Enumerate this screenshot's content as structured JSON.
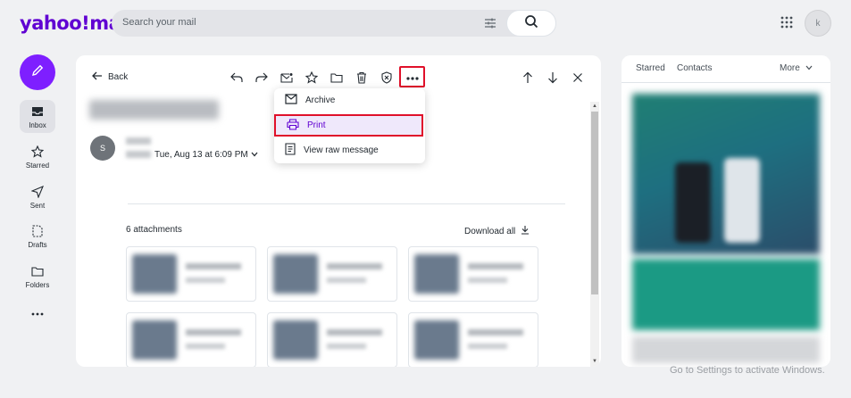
{
  "app": {
    "logo": "yahoo!mail"
  },
  "search": {
    "placeholder": "Search your mail"
  },
  "account": {
    "avatar_initial": "k"
  },
  "sidebar": {
    "items": [
      {
        "label": "Inbox"
      },
      {
        "label": "Starred"
      },
      {
        "label": "Sent"
      },
      {
        "label": "Drafts"
      },
      {
        "label": "Folders"
      }
    ]
  },
  "toolbar": {
    "back_label": "Back"
  },
  "message": {
    "sender_initial": "S",
    "date": "Tue, Aug 13 at 6:09 PM",
    "attachments_count_label": "6 attachments",
    "download_all_label": "Download all"
  },
  "more_menu": {
    "items": [
      {
        "label": "Archive"
      },
      {
        "label": "Print"
      },
      {
        "label": "View raw message"
      }
    ]
  },
  "right_panel": {
    "tabs": [
      {
        "label": "Starred"
      },
      {
        "label": "Contacts"
      }
    ],
    "more_label": "More"
  },
  "watermark": "Go to Settings to activate Windows.",
  "colors": {
    "brand": "#6001d2",
    "compose": "#7e1fff",
    "highlight_border": "#e0102a"
  }
}
